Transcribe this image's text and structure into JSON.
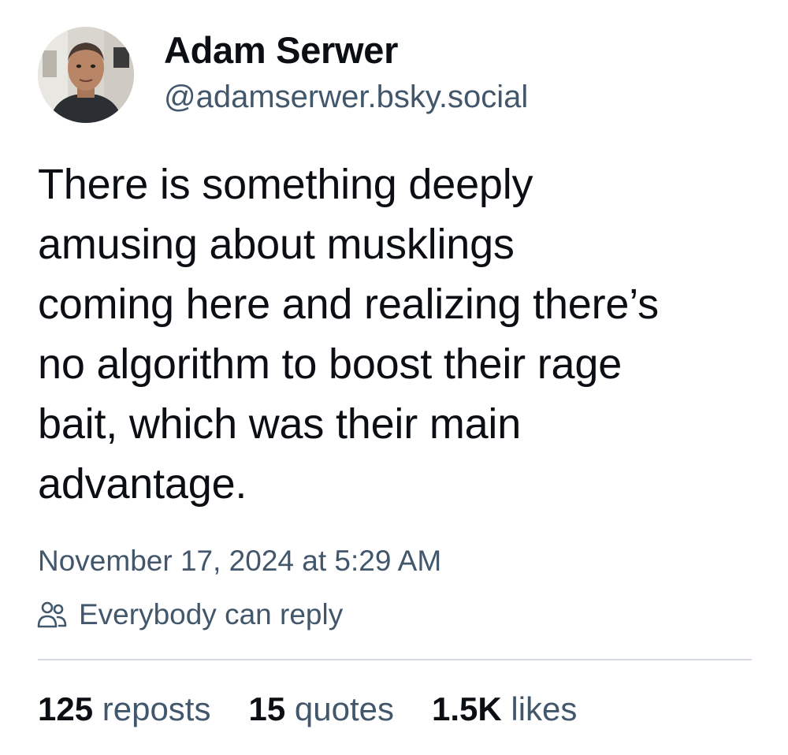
{
  "author": {
    "display_name": "Adam Serwer",
    "handle": "@adamserwer.bsky.social",
    "avatar_icon": "profile-photo"
  },
  "post": {
    "text": "There is something deeply\namusing about musklings\ncoming here and realizing there’s\nno algorithm to boost their rage\nbait, which was their main\nadvantage.",
    "timestamp": "November 17, 2024 at 5:29 AM",
    "reply_setting": "Everybody can reply",
    "reply_setting_icon": "people-icon"
  },
  "stats": {
    "reposts_count": "125",
    "reposts_label": "reposts",
    "quotes_count": "15",
    "quotes_label": "quotes",
    "likes_count": "1.5K",
    "likes_label": "likes"
  },
  "colors": {
    "text": "#0b0f14",
    "muted": "#42576c",
    "divider": "#d4dbe2",
    "background": "#ffffff"
  }
}
